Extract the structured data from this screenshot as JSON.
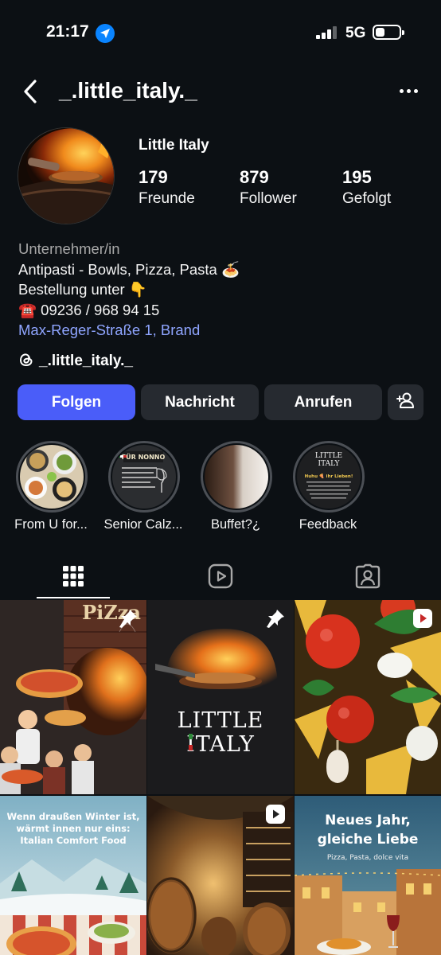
{
  "status": {
    "time": "21:17",
    "network": "5G"
  },
  "header": {
    "handle": "_.little_italy._"
  },
  "profile": {
    "name": "Little Italy",
    "stats": [
      {
        "value": "179",
        "label": "Freunde"
      },
      {
        "value": "879",
        "label": "Follower"
      },
      {
        "value": "195",
        "label": "Gefolgt"
      }
    ],
    "category": "Unternehmer/in",
    "bio_lines": [
      "Antipasti - Bowls, Pizza, Pasta 🍝",
      "Bestellung unter 👇",
      "☎️ 09236 / 968 94 15"
    ],
    "address": "Max-Reger-Straße 1, Brand",
    "threads_handle": "_.little_italy._"
  },
  "buttons": {
    "follow": "Folgen",
    "message": "Nachricht",
    "call": "Anrufen"
  },
  "highlights": [
    {
      "label": "From U for..."
    },
    {
      "label": "Senior Calz..."
    },
    {
      "label": "Buffet?¿"
    },
    {
      "label": "Feedback"
    }
  ],
  "highlight_texts": {
    "senior_badge": "FÜR NONNO",
    "feedback_logo_1": "LITTLE",
    "feedback_logo_2": "ITALY",
    "feedback_text": "Huhu 🍕 ihr Lieben!"
  },
  "posts": {
    "post1_sign": "PiZza",
    "post2_logo_line1": "LITTLE",
    "post2_logo_line2": "ITALY",
    "post4_text_line1": "Wenn draußen Winter ist,",
    "post4_text_line2": "wärmt innen nur eins:",
    "post4_text_line3": "Italian Comfort Food",
    "post6_title_line1": "Neues Jahr,",
    "post6_title_line2": "gleiche Liebe",
    "post6_subtitle": "Pizza, Pasta, dolce vita"
  },
  "colors": {
    "accent": "#4a5df9",
    "link": "#8fa5ff",
    "background": "#0c1014",
    "button": "#262a30"
  }
}
